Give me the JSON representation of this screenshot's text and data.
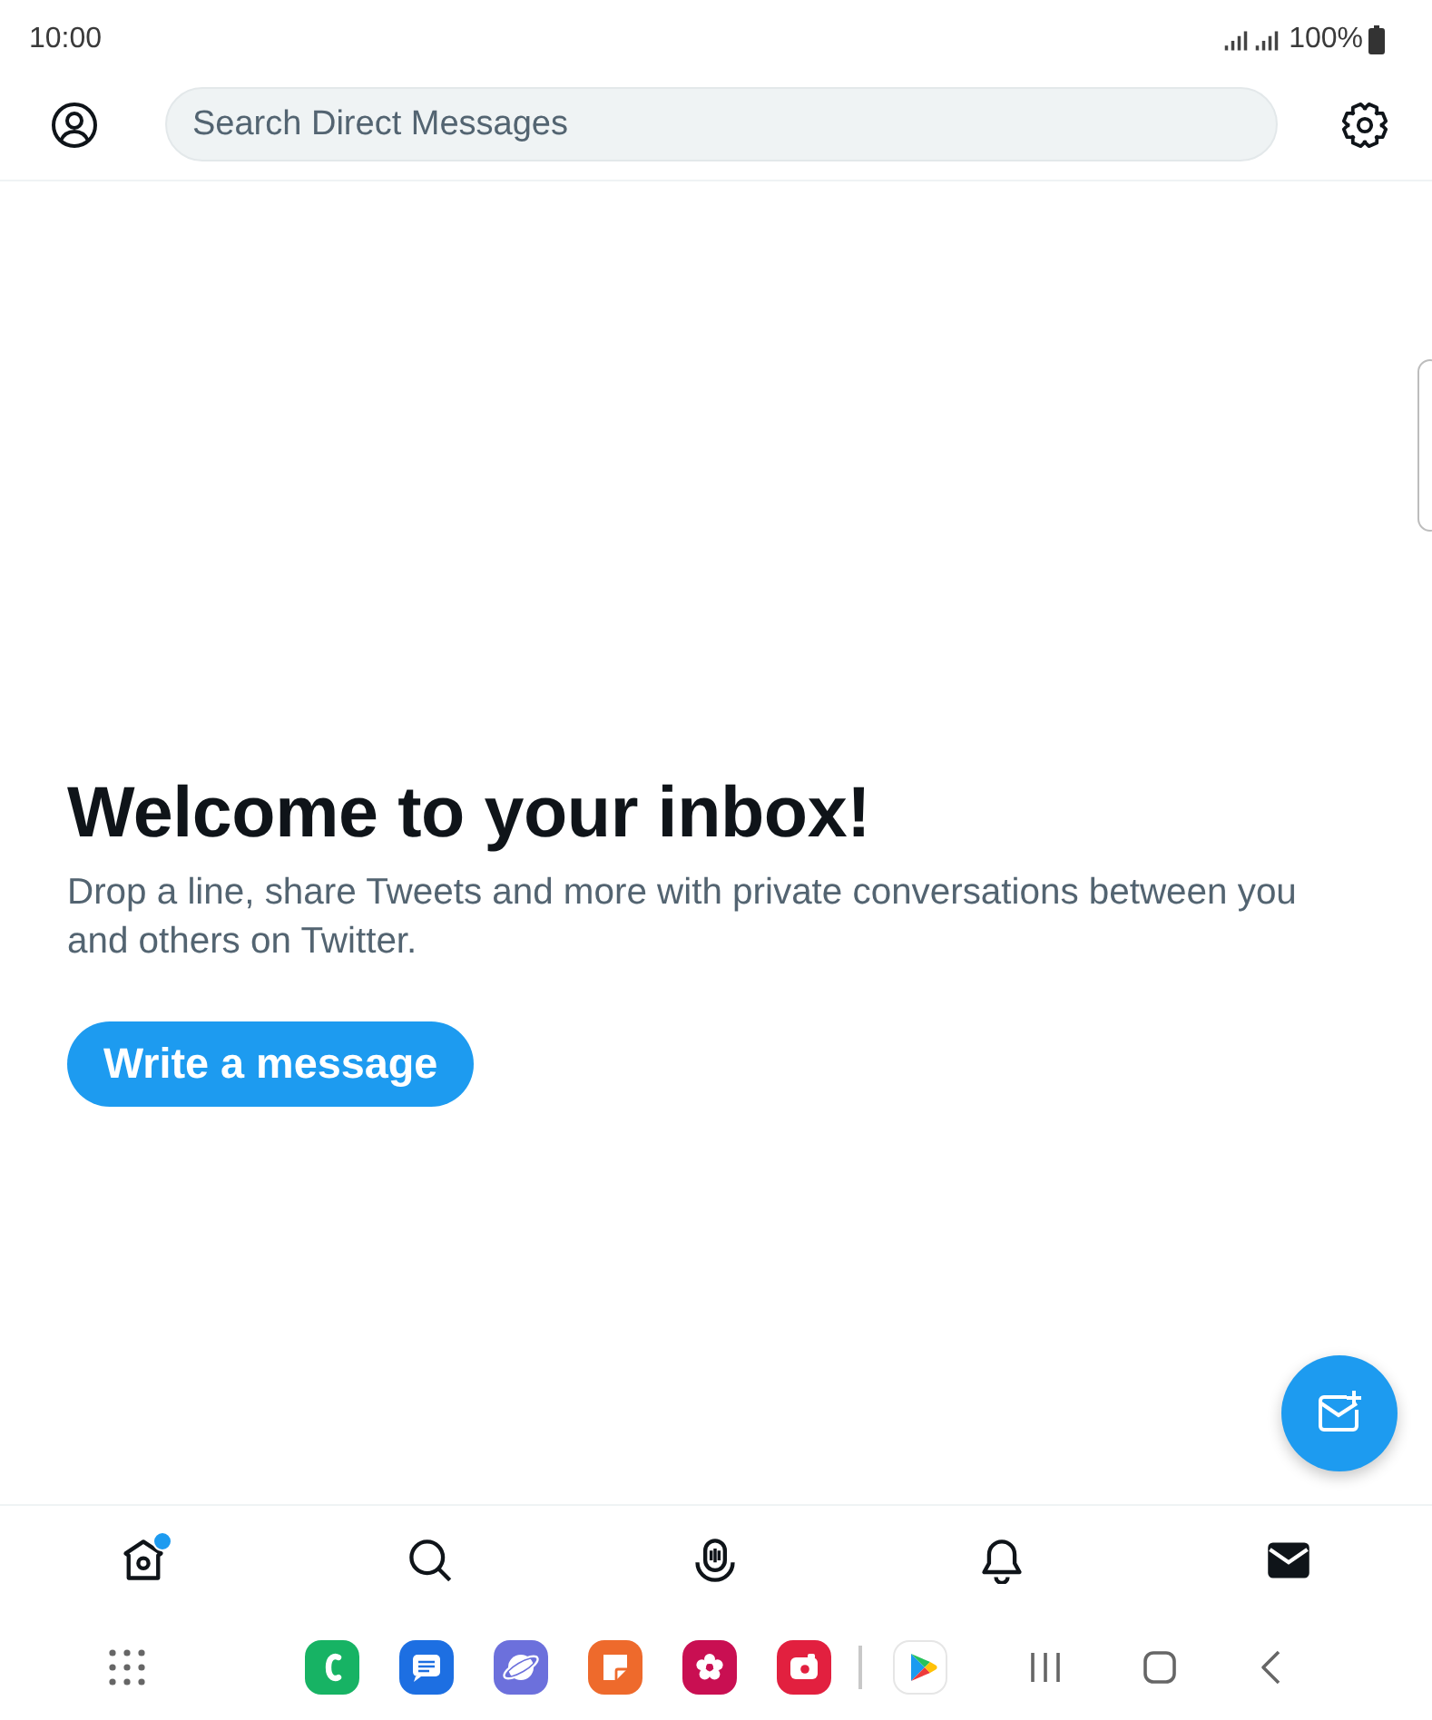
{
  "status_bar": {
    "time": "10:00",
    "battery": "100%"
  },
  "header": {
    "search": {
      "placeholder": "Search Direct Messages"
    }
  },
  "empty_state": {
    "title": "Welcome to your inbox!",
    "body": "Drop a line, share Tweets and more with private conversations between you and others on Twitter.",
    "button": "Write a message"
  },
  "bottom_nav": [
    {
      "kind": "home",
      "selected": false,
      "badge": true
    },
    {
      "kind": "explore",
      "selected": false,
      "badge": false
    },
    {
      "kind": "spaces",
      "selected": false,
      "badge": false
    },
    {
      "kind": "notifications",
      "selected": false,
      "badge": false
    },
    {
      "kind": "messages",
      "selected": true,
      "badge": false
    }
  ],
  "dock": {
    "pinned": [
      {
        "kind": "phone",
        "color": "#17b364"
      },
      {
        "kind": "chat",
        "color": "#1d6fe2"
      },
      {
        "kind": "browser",
        "color": "#6c70dc"
      },
      {
        "kind": "notes",
        "color": "#ee6a2c"
      },
      {
        "kind": "gallery",
        "color": "#c90f52"
      },
      {
        "kind": "camera",
        "color": "#e2203f"
      }
    ],
    "recent": [
      {
        "kind": "store",
        "color": "#ffffff"
      }
    ]
  }
}
